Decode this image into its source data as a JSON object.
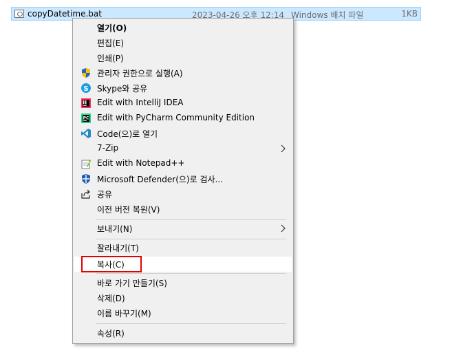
{
  "file": {
    "name": "copyDatetime.bat",
    "date": "2023-04-26 오후 12:14",
    "type": "Windows 배치 파일",
    "size": "1KB"
  },
  "menu": {
    "items": [
      {
        "label": "열기(O)",
        "icon": ""
      },
      {
        "label": "편집(E)",
        "icon": ""
      },
      {
        "label": "인쇄(P)",
        "icon": ""
      },
      {
        "label": "관리자 권한으로 실행(A)",
        "icon": "uac-shield-icon"
      },
      {
        "label": "Skype와 공유",
        "icon": "skype-icon"
      },
      {
        "label": "Edit with IntelliJ IDEA",
        "icon": "intellij-icon"
      },
      {
        "label": "Edit with PyCharm Community Edition",
        "icon": "pycharm-icon"
      },
      {
        "label": "Code(으)로 열기",
        "icon": "vscode-icon"
      },
      {
        "label": "7-Zip",
        "icon": ""
      },
      {
        "label": "Edit with Notepad++",
        "icon": "notepadpp-icon"
      },
      {
        "label": "Microsoft Defender(으)로 검사...",
        "icon": "defender-icon"
      },
      {
        "label": "공유",
        "icon": "share-icon"
      },
      {
        "label": "이전 버전 복원(V)",
        "icon": ""
      },
      {
        "label": "보내기(N)",
        "icon": ""
      },
      {
        "label": "잘라내기(T)",
        "icon": ""
      },
      {
        "label": "복사(C)",
        "icon": ""
      },
      {
        "label": "바로 가기 만들기(S)",
        "icon": ""
      },
      {
        "label": "삭제(D)",
        "icon": ""
      },
      {
        "label": "이름 바꾸기(M)",
        "icon": ""
      },
      {
        "label": "속성(R)",
        "icon": ""
      }
    ]
  },
  "colors": {
    "selection": "#cce8ff",
    "highlight_box": "#e00000",
    "menu_bg": "#f0f0f0"
  }
}
